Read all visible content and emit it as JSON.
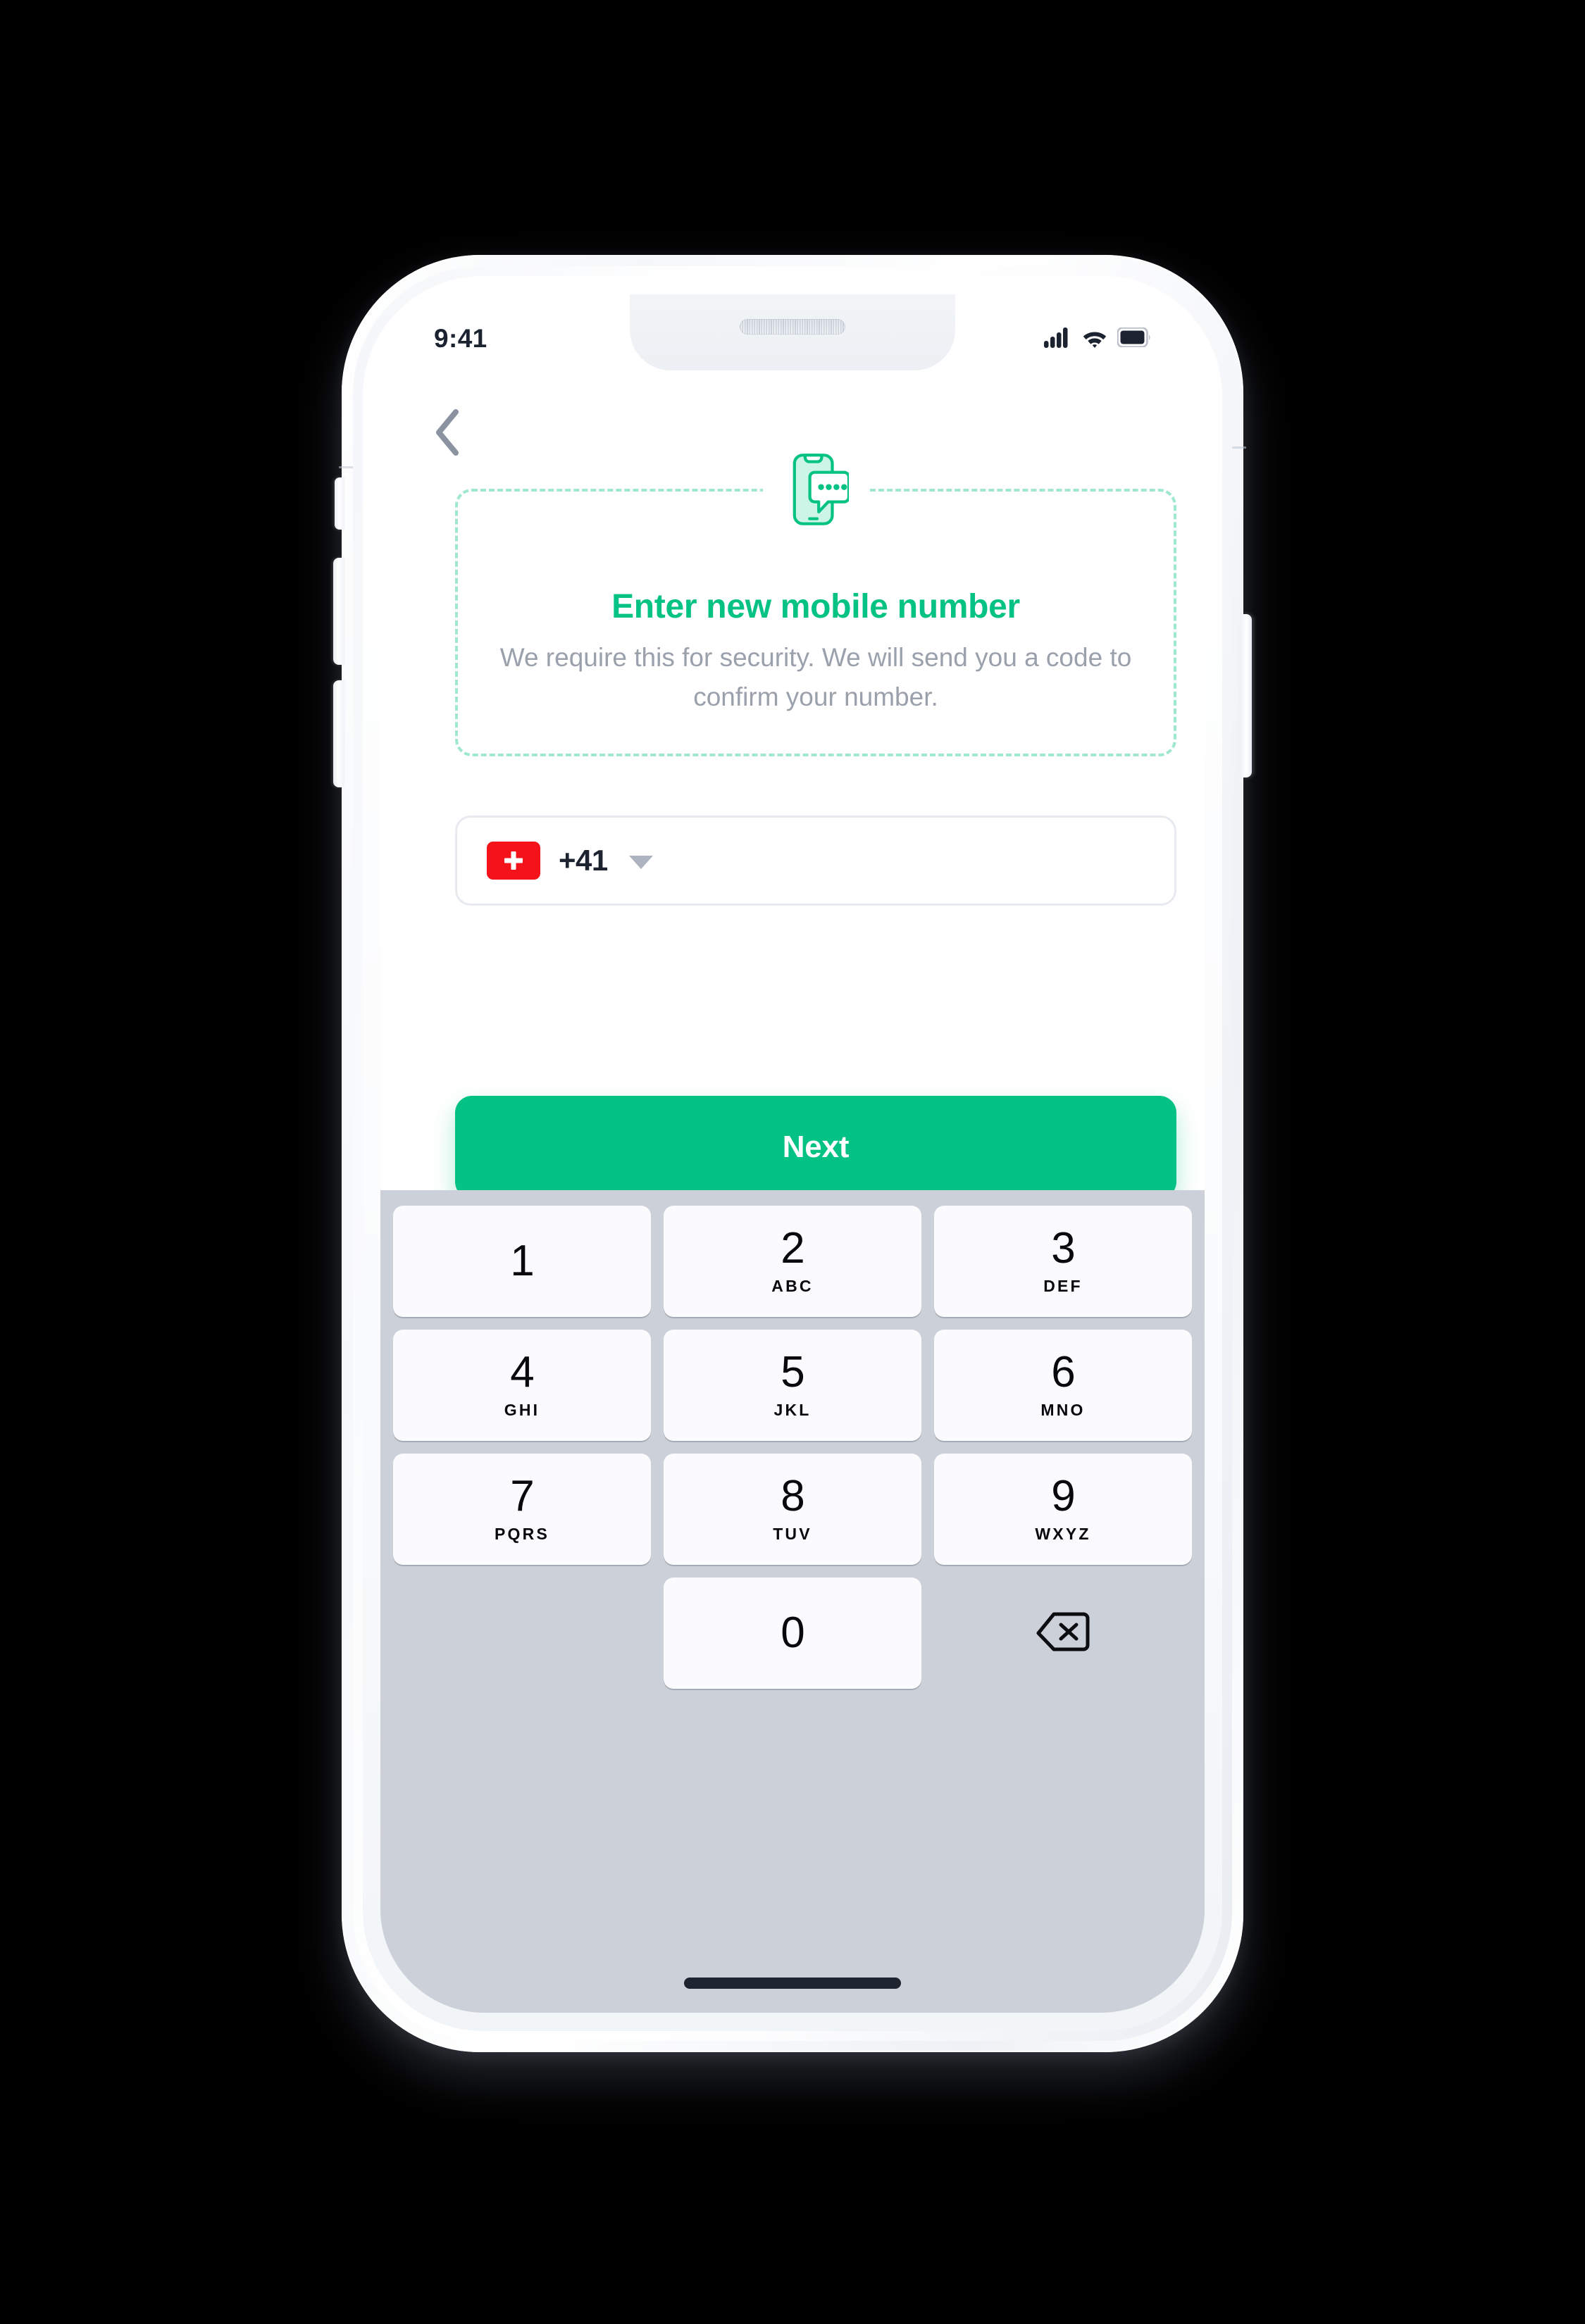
{
  "status_bar": {
    "time": "9:41",
    "signal_icon": "cellular-signal-icon",
    "wifi_icon": "wifi-icon",
    "battery_icon": "battery-full-icon"
  },
  "nav": {
    "back_icon": "chevron-left-icon"
  },
  "info_card": {
    "icon": "sms-phone-message-icon",
    "title": "Enter new mobile number",
    "description": "We require this for security. We will send you a code to confirm your number."
  },
  "phone_field": {
    "flag_icon": "swiss-flag-icon",
    "country_code": "+41",
    "dropdown_icon": "triangle-down-icon",
    "number_value": "",
    "number_placeholder": ""
  },
  "primary_action": {
    "label": "Next"
  },
  "keyboard": {
    "rows": [
      [
        {
          "digit": "1",
          "letters": ""
        },
        {
          "digit": "2",
          "letters": "ABC"
        },
        {
          "digit": "3",
          "letters": "DEF"
        }
      ],
      [
        {
          "digit": "4",
          "letters": "GHI"
        },
        {
          "digit": "5",
          "letters": "JKL"
        },
        {
          "digit": "6",
          "letters": "MNO"
        }
      ],
      [
        {
          "digit": "7",
          "letters": "PQRS"
        },
        {
          "digit": "8",
          "letters": "TUV"
        },
        {
          "digit": "9",
          "letters": "WXYZ"
        }
      ]
    ],
    "zero": {
      "digit": "0",
      "letters": ""
    },
    "delete_icon": "backspace-delete-icon"
  },
  "colors": {
    "accent_green": "#04c184",
    "flag_red": "#f4121b",
    "dashed_border": "#9fe8cf",
    "body_text": "#9aa1ac",
    "keyboard_bg": "#ccd0d8",
    "key_bg": "#fbfbfd",
    "background": "#000000"
  },
  "device": {
    "home_indicator": "home-indicator-bar",
    "notch": "device-notch",
    "speaker": "earpiece-speaker-grille"
  }
}
